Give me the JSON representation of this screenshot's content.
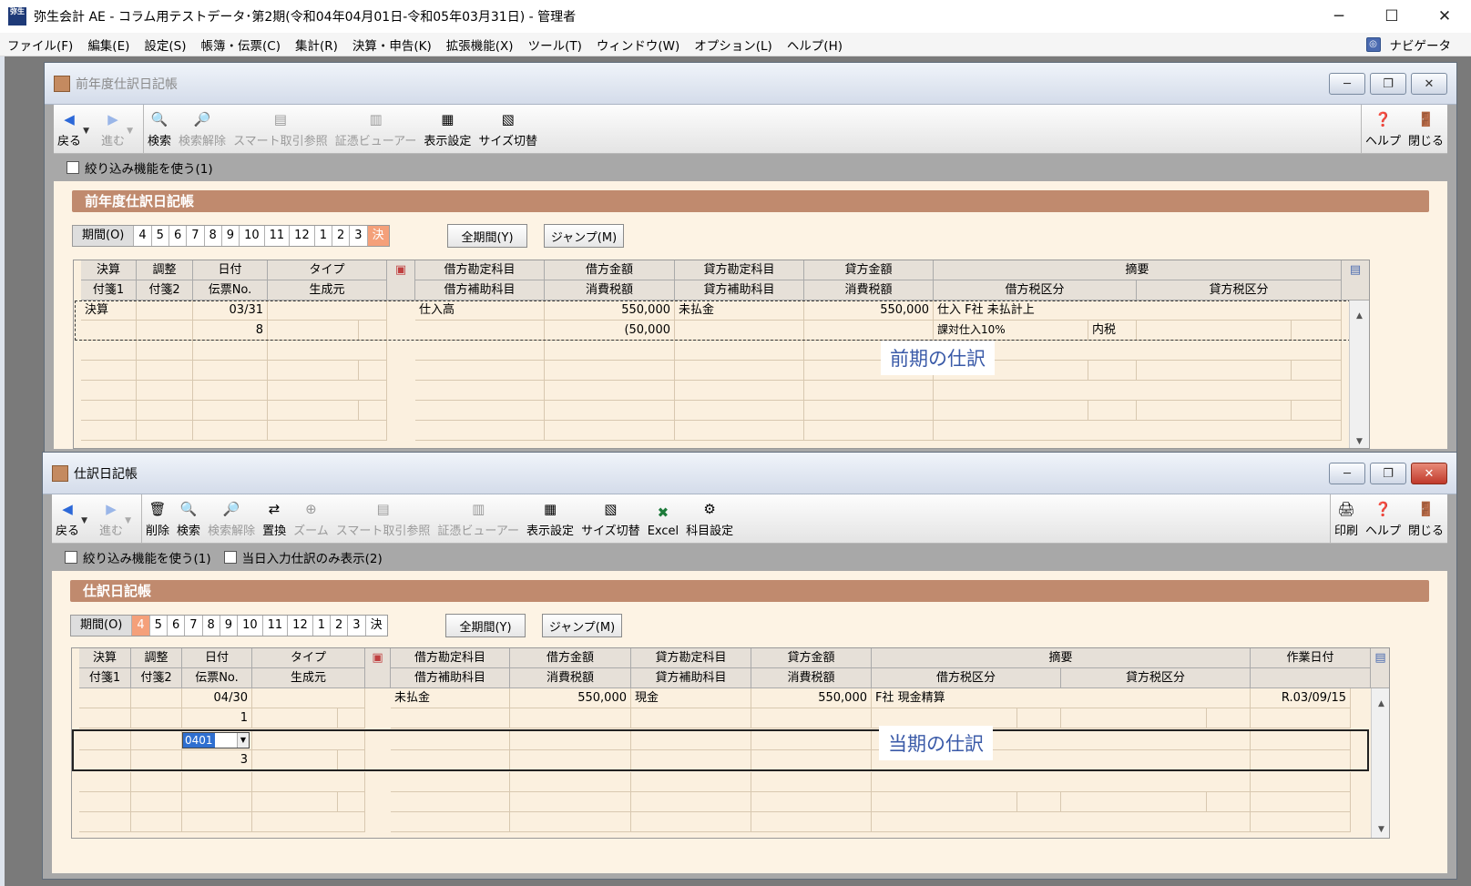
{
  "app": {
    "logo_text": "弥生",
    "title": "弥生会計 AE - コラム用テストデータ･第2期(令和04年04月01日-令和05年03月31日) - 管理者",
    "ctrl_min": "─",
    "ctrl_max": "☐",
    "ctrl_close": "✕"
  },
  "menu": {
    "items": [
      {
        "label": "ファイル(F)"
      },
      {
        "label": "編集(E)"
      },
      {
        "label": "設定(S)"
      },
      {
        "label": "帳簿・伝票(C)"
      },
      {
        "label": "集計(R)"
      },
      {
        "label": "決算・申告(K)"
      },
      {
        "label": "拡張機能(X)"
      },
      {
        "label": "ツール(T)"
      },
      {
        "label": "ウィンドウ(W)"
      },
      {
        "label": "オプション(L)"
      },
      {
        "label": "ヘルプ(H)"
      }
    ],
    "navigator": "ナビゲータ"
  },
  "prev_window": {
    "title": "前年度仕訳日記帳",
    "toolbar": {
      "back": "戻る",
      "forward": "進む",
      "search": "検索",
      "search_clear": "検索解除",
      "smart": "スマート取引参照",
      "viewer": "証憑ビューアー",
      "display": "表示設定",
      "size": "サイズ切替",
      "help": "ヘルプ",
      "close": "閉じる"
    },
    "filter_label": "絞り込み機能を使う(1)",
    "banner": "前年度仕訳日記帳",
    "period_label": "期間(O)",
    "periods": [
      "4",
      "5",
      "6",
      "7",
      "8",
      "9",
      "10",
      "11",
      "12",
      "1",
      "2",
      "3",
      "決"
    ],
    "period_selected": "決",
    "btn_all": "全期間(Y)",
    "btn_jump": "ジャンプ(M)",
    "headers": {
      "kessan": "決算",
      "chosei": "調整",
      "hiduke": "日付",
      "type": "タイプ",
      "fusen1": "付箋1",
      "fusen2": "付箋2",
      "denpyo": "伝票No.",
      "seisei": "生成元",
      "kari_kamoku": "借方勘定科目",
      "kari_kingaku": "借方金額",
      "kashi_kamoku": "貸方勘定科目",
      "kashi_kingaku": "貸方金額",
      "tekiyo": "摘要",
      "kari_hojo": "借方補助科目",
      "shohizei1": "消費税額",
      "kashi_hojo": "貸方補助科目",
      "shohizei2": "消費税額",
      "kari_zei": "借方税区分",
      "kashi_zei": "貸方税区分"
    },
    "row": {
      "kessan": "決算",
      "date": "03/31",
      "debit": "仕入高",
      "debit_amt": "550,000",
      "credit": "未払金",
      "credit_amt": "550,000",
      "memo": "仕入 F社 未払計上",
      "voucher": "8",
      "tax": "(50,000",
      "tax_kubun": "課対仕入10%",
      "naizei": "内税"
    },
    "overlay": "前期の仕訳"
  },
  "cur_window": {
    "title": "仕訳日記帳",
    "toolbar": {
      "back": "戻る",
      "forward": "進む",
      "delete": "削除",
      "search": "検索",
      "search_clear": "検索解除",
      "replace": "置換",
      "zoom": "ズーム",
      "smart": "スマート取引参照",
      "viewer": "証憑ビューアー",
      "display": "表示設定",
      "size": "サイズ切替",
      "excel": "Excel",
      "kamoku": "科目設定",
      "print": "印刷",
      "help": "ヘルプ",
      "close": "閉じる"
    },
    "filter_label": "絞り込み機能を使う(1)",
    "filter_label2": "当日入力仕訳のみ表示(2)",
    "banner": "仕訳日記帳",
    "period_label": "期間(O)",
    "periods": [
      "4",
      "5",
      "6",
      "7",
      "8",
      "9",
      "10",
      "11",
      "12",
      "1",
      "2",
      "3",
      "決"
    ],
    "period_selected": "4",
    "btn_all": "全期間(Y)",
    "btn_jump": "ジャンプ(M)",
    "headers": {
      "kessan": "決算",
      "chosei": "調整",
      "hiduke": "日付",
      "type": "タイプ",
      "fusen1": "付箋1",
      "fusen2": "付箋2",
      "denpyo": "伝票No.",
      "seisei": "生成元",
      "kari_kamoku": "借方勘定科目",
      "kari_kingaku": "借方金額",
      "kashi_kamoku": "貸方勘定科目",
      "kashi_kingaku": "貸方金額",
      "tekiyo": "摘要",
      "sagyo": "作業日付",
      "kari_hojo": "借方補助科目",
      "shohizei1": "消費税額",
      "kashi_hojo": "貸方補助科目",
      "shohizei2": "消費税額",
      "kari_zei": "借方税区分",
      "kashi_zei": "貸方税区分"
    },
    "row": {
      "date": "04/30",
      "debit": "未払金",
      "debit_amt": "550,000",
      "credit": "現金",
      "credit_amt": "550,000",
      "memo": "F社 現金精算",
      "work_date": "R.03/09/15",
      "voucher": "1"
    },
    "edit": {
      "date_value": "0401",
      "voucher": "3"
    },
    "overlay": "当期の仕訳"
  }
}
